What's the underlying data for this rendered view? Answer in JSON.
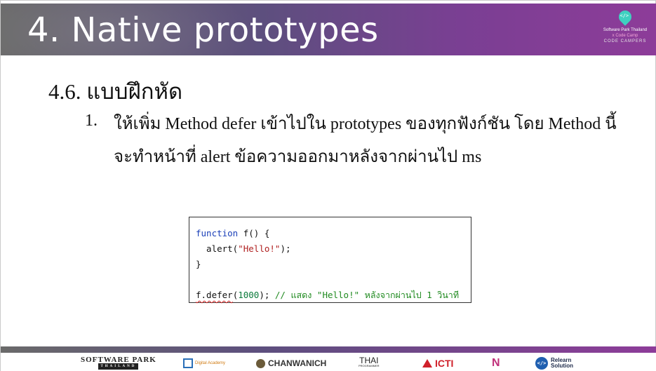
{
  "header": {
    "title": "4. Native prototypes",
    "brand": {
      "line1": "Software Park Thailand",
      "line2": "x Code Camp",
      "line3": "CODE CAMPERS",
      "icon": "code-pin-icon"
    }
  },
  "content": {
    "section_heading": "4.6. แบบฝึกหัด",
    "item_number": "1.",
    "item_line1": "ให้เพิ่ม Method defer เข้าไปใน prototypes ของทุกฟังก์ชัน โดย Method นี้",
    "item_line2": "จะทำหน้าที่ alert ข้อความออกมาหลังจากผ่านไป ms"
  },
  "code": {
    "l1_kw": "function",
    "l1_rest": " f() {",
    "l2_pre": "  alert(",
    "l2_str": "\"Hello!\"",
    "l2_post": ");",
    "l3": "}",
    "l5_fn": "f.defer",
    "l5_open": "(",
    "l5_num": "1000",
    "l5_close": "); ",
    "l5_comment": "// แสดง \"Hello!\" หลังจากผ่านไป 1 วินาที"
  },
  "footer": {
    "logos": {
      "software_park": "SOFTWARE PARK",
      "software_park_sub": "THAILAND",
      "digital_academy": "Digital Academy",
      "chanwanich": "CHANWANICH",
      "thai": "THAI",
      "thai_sub": "PROGRAMMER",
      "icti": "ICTI",
      "n_logo": "N",
      "relearn_line1": "Relearn",
      "relearn_line2": "Solution",
      "relearn_icon": "</>"
    }
  },
  "colors": {
    "header_start": "#6a6a6a",
    "header_end": "#8d3c99",
    "keyword": "#1a3fb8",
    "string": "#b02020",
    "number": "#0a7a3a",
    "comment": "#1f8a1f"
  }
}
